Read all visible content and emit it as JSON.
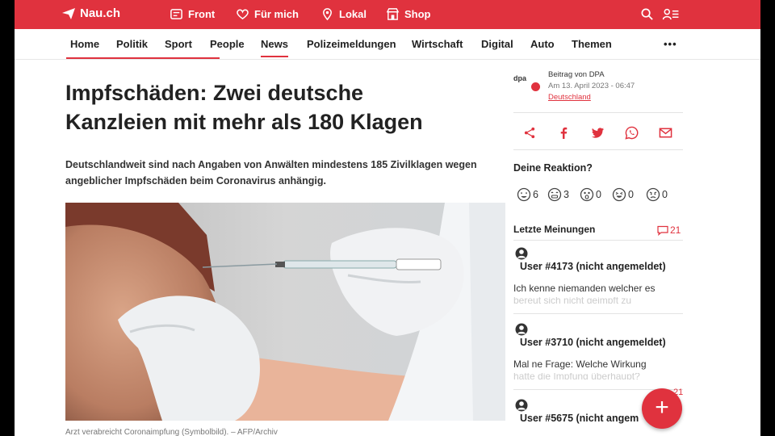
{
  "topbar": {
    "brand": "Nau.ch",
    "nav": [
      {
        "label": "Front",
        "icon": "front-icon"
      },
      {
        "label": "Für mich",
        "icon": "heart-icon"
      },
      {
        "label": "Lokal",
        "icon": "location-pin-icon"
      },
      {
        "label": "Shop",
        "icon": "shop-icon"
      }
    ],
    "right_icons": [
      "search-icon",
      "user-menu-icon"
    ]
  },
  "subnav": {
    "items": [
      "Home",
      "Politik",
      "Sport",
      "People",
      "News",
      "Polizeimeldungen",
      "Wirtschaft",
      "Digital",
      "Auto",
      "Themen"
    ],
    "active": "News",
    "more": "•••"
  },
  "article": {
    "headline_line1": "Impfschäden: Zwei deutsche",
    "headline_line2": "Kanzleien mit mehr als 180 Klagen",
    "lead": "Deutschlandweit sind nach Angaben von Anwälten mindestens 185 Zivilklagen wegen angeblicher Impfschäden beim Coronavirus anhängig.",
    "caption": "Arzt verabreicht Coronaimpfung (Symbolbild). – AFP/Archiv"
  },
  "byline": {
    "logo": "dpa",
    "by": "Beitrag von DPA",
    "date": "Am 13. April 2023 - 06:47",
    "region": "Deutschland"
  },
  "share": [
    "share-icon",
    "facebook-icon",
    "twitter-icon",
    "whatsapp-icon",
    "mail-icon"
  ],
  "reactions": {
    "title": "Deine Reaktion?",
    "items": [
      {
        "icon": "heart-eyes-emoji-icon",
        "count": "6"
      },
      {
        "icon": "grin-emoji-icon",
        "count": "3"
      },
      {
        "icon": "surprised-emoji-icon",
        "count": "0"
      },
      {
        "icon": "laughing-emoji-icon",
        "count": "0"
      },
      {
        "icon": "angry-emoji-icon",
        "count": "0"
      }
    ]
  },
  "comments": {
    "title": "Letzte Meinungen",
    "count": "21",
    "items": [
      {
        "user": "User #4173 (nicht angemeldet)",
        "text": "Ich kenne niemanden welcher es",
        "fade": "bereut sich nicht geimpft zu"
      },
      {
        "user": "User #3710 (nicht angemeldet)",
        "text": "Mal ne Frage: Welche Wirkung",
        "fade": "hatte die Impfung überhaupt?"
      },
      {
        "user": "User #5675 (nicht angem",
        "text": "",
        "fade": ""
      }
    ]
  },
  "fab": {
    "label": "+",
    "badge": "21"
  },
  "colors": {
    "brand": "#e0323e"
  }
}
